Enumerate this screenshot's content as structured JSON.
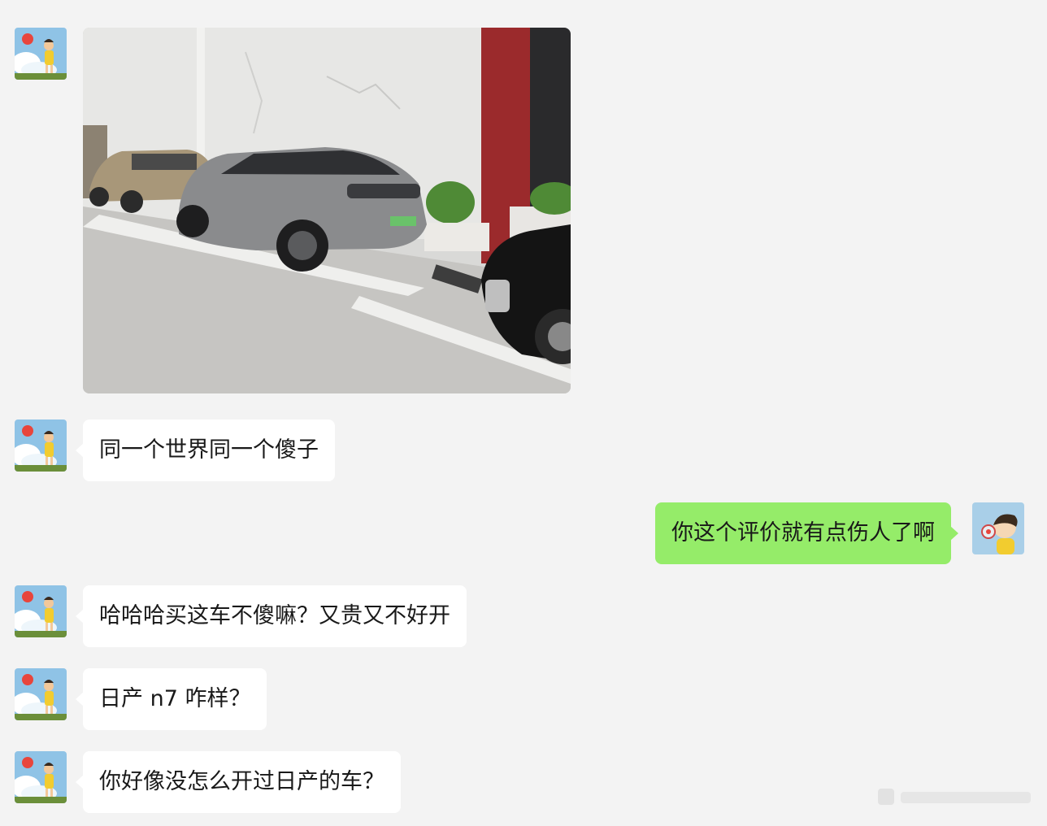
{
  "colors": {
    "background": "#f3f3f3",
    "incoming_bubble": "#ffffff",
    "outgoing_bubble": "#95ec69",
    "text": "#191919"
  },
  "messages": [
    {
      "side": "left",
      "type": "image",
      "avatar": "ponyo-avatar"
    },
    {
      "side": "left",
      "type": "text",
      "text": "同一个世界同一个傻子",
      "avatar": "ponyo-avatar"
    },
    {
      "side": "right",
      "type": "text",
      "text": "你这个评价就有点伤人了啊",
      "avatar": "sosuke-avatar"
    },
    {
      "side": "left",
      "type": "text",
      "text": "哈哈哈买这车不傻嘛？又贵又不好开",
      "avatar": "ponyo-avatar"
    },
    {
      "side": "left",
      "type": "text",
      "text": "日产 n7 咋样？",
      "avatar": "ponyo-avatar"
    },
    {
      "side": "left",
      "type": "text",
      "text": "你好像没怎么开过日产的车？",
      "avatar": "ponyo-avatar"
    }
  ]
}
